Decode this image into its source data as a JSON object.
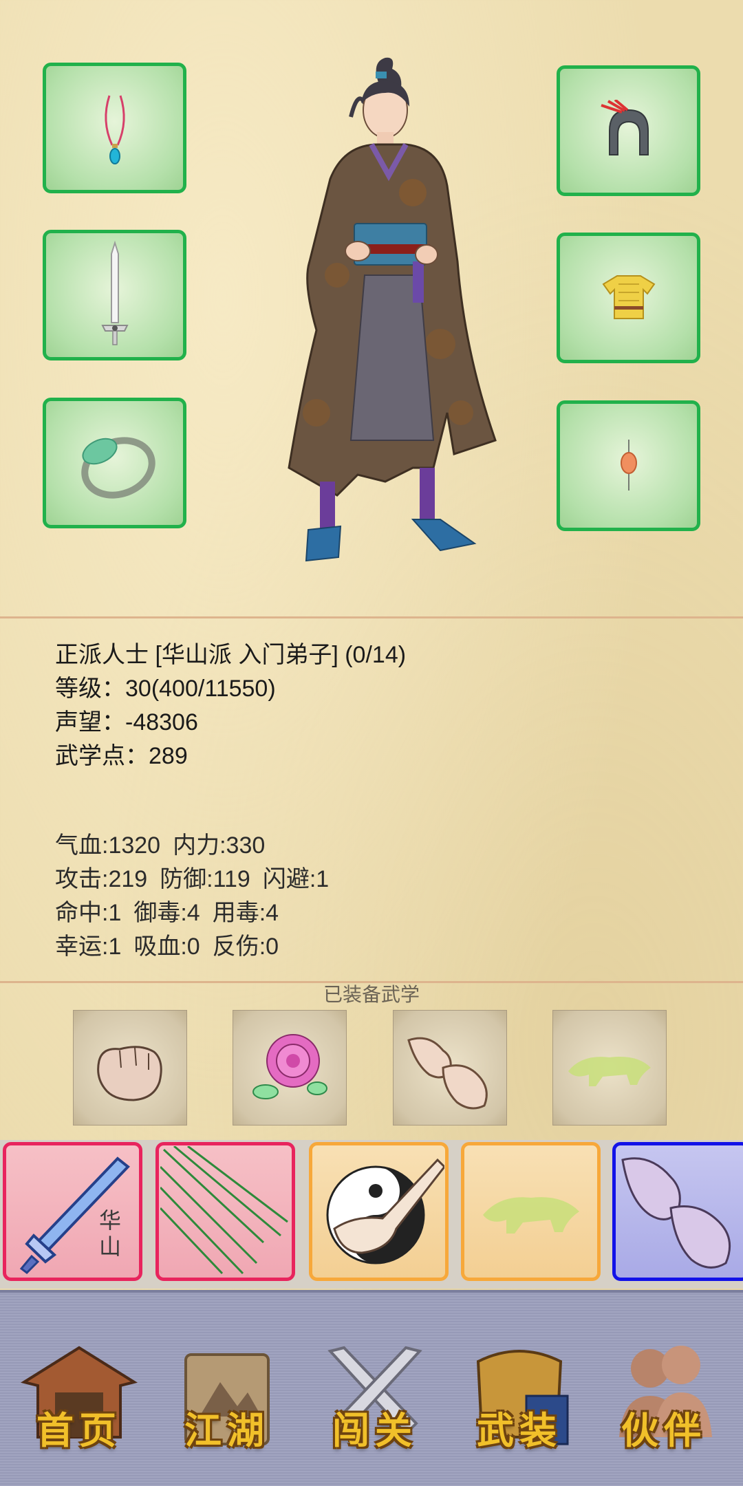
{
  "equipment": {
    "left": [
      "necklace-icon",
      "sword-icon",
      "jade-ring-icon"
    ],
    "right": [
      "helmet-icon",
      "armor-icon",
      "pendant-icon"
    ],
    "border_color": "#21b14b"
  },
  "character": {
    "faction_line": "正派人士 [华山派 入门弟子] (0/14)",
    "level_line": "等级：30(400/11550)",
    "reputation_line": "声望：-48306",
    "martial_points_line": "武学点：289"
  },
  "stats": {
    "hp": "气血:1320",
    "mp": "内力:330",
    "attack": "攻击:219",
    "defense": "防御:119",
    "dodge": "闪避:1",
    "hit": "命中:1",
    "poison_resist": "御毒:4",
    "poison_use": "用毒:4",
    "luck": "幸运:1",
    "lifesteal": "吸血:0",
    "reflect": "反伤:0"
  },
  "equipped_skills": {
    "title": "已装备武学",
    "icons": [
      "fist-icon",
      "rose-icon",
      "clasped-hands-icon",
      "leopard-icon"
    ]
  },
  "quick_slots": {
    "items": [
      {
        "icon": "huashan-sword-icon",
        "text": "华山",
        "quality": "red"
      },
      {
        "icon": "needles-icon",
        "text": "",
        "quality": "red"
      },
      {
        "icon": "taiji-palm-icon",
        "text": "",
        "quality": "orange"
      },
      {
        "icon": "leopard-icon",
        "text": "",
        "quality": "orange"
      },
      {
        "icon": "clasped-hands-icon",
        "text": "",
        "quality": "blue"
      }
    ],
    "colors": {
      "red": "#e8245d",
      "orange": "#f7a83a",
      "blue": "#1212e8"
    }
  },
  "nav": {
    "items": [
      {
        "label": "首页",
        "icon": "house-icon"
      },
      {
        "label": "江湖",
        "icon": "scroll-icon"
      },
      {
        "label": "闯关",
        "icon": "crossed-swords-icon"
      },
      {
        "label": "武装",
        "icon": "armor-book-icon"
      },
      {
        "label": "伙伴",
        "icon": "companions-icon"
      }
    ]
  }
}
